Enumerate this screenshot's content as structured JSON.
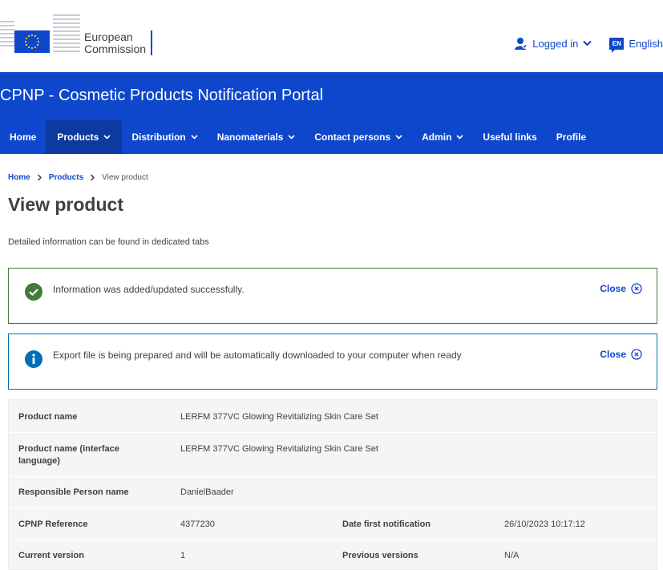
{
  "header": {
    "logo_line1": "European",
    "logo_line2": "Commission",
    "logged_in": "Logged in",
    "language_code": "EN",
    "language": "English",
    "brand_color": "#0e47cb"
  },
  "site": {
    "title": "CPNP - Cosmetic Products Notification Portal"
  },
  "nav": {
    "items": [
      {
        "label": "Home"
      },
      {
        "label": "Products"
      },
      {
        "label": "Distribution"
      },
      {
        "label": "Nanomaterials"
      },
      {
        "label": "Contact persons"
      },
      {
        "label": "Admin"
      },
      {
        "label": "Useful links"
      },
      {
        "label": "Profile"
      }
    ]
  },
  "breadcrumb": {
    "home": "Home",
    "products": "Products",
    "current": "View product"
  },
  "page": {
    "title": "View product",
    "description": "Detailed information can be found in dedicated tabs"
  },
  "messages": {
    "success": {
      "text": "Information was added/updated successfully.",
      "close": "Close",
      "color": "#467a39"
    },
    "info": {
      "text": "Export file is being prepared and will be automatically downloaded to your computer when ready",
      "close": "Close",
      "color": "#006fb4"
    }
  },
  "product": {
    "name_label": "Product name",
    "name_value": "LERFM 377VC Glowing Revitalizing Skin Care Set",
    "name_interface_label": "Product name (interface language)",
    "name_interface_value": "LERFM 377VC Glowing Revitalizing Skin Care Set",
    "rp_label": "Responsible Person name",
    "rp_value": "DanielBaader",
    "cpnp_label": "CPNP Reference",
    "cpnp_value": "4377230",
    "date_label": "Date first notification",
    "date_value": "26/10/2023 10:17:12",
    "version_label": "Current version",
    "version_value": "1",
    "prev_label": "Previous versions",
    "prev_value": "N/A"
  }
}
